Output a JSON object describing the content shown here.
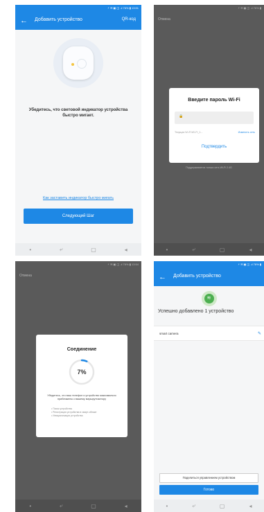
{
  "screen1": {
    "status": "⚡ ✉ ▣ ◫ .ıl 76% ▮ 13:51",
    "title": "Добавить устройство",
    "right_action": "QR-код",
    "instruction": "Убедитесь, что световой индикатор устройства быстро мигает.",
    "help_link": "Как заставить индикатор быстро мигать",
    "next_button": "Следующий Шаг"
  },
  "screen2": {
    "status": "⚡ ✉ ▣ ◫ .ıl 76% ▮",
    "cancel": "Отмена",
    "dialog_title": "Введите пароль Wi-Fi",
    "current_network": "Текущая Wi-Fi:WI-FI_1...",
    "change_network": "Изменить сеть",
    "confirm": "Подтвердить",
    "support_note": "Поддерживается только сеть Wi-Fi 2.4G"
  },
  "screen3": {
    "status": "⚡ ✉ ▣ ◫ .ıl 76% ▮ 13:54",
    "cancel": "Отмена",
    "dialog_title": "Соединение",
    "percent": "7%",
    "progress": 0.07,
    "note": "Убедитесь, что ваш телефон и устройство максимально приближены к вашему маршрутизатору",
    "steps": [
      "Поиск устройства",
      "Регистрация устройства в смарт-облаке",
      "Инициализация устройства"
    ]
  },
  "screen4": {
    "status": "⚡ ✉ ▣ ◫ .ıl 76% ▮",
    "title": "Добавить устройство",
    "success": "Успешно добавлено 1 устройство",
    "device_name": "smart camera",
    "share_button": "Поделиться управлением устройством",
    "done_button": "Готово"
  },
  "nav": {
    "back": "◂",
    "home": "▢",
    "recents": "⤶",
    "menu": "•"
  },
  "icons": {
    "back_arrow": "←",
    "lock": "🔒",
    "wifi": "≋",
    "edit": "✎"
  },
  "colors": {
    "primary": "#1e88e5",
    "success": "#4caf50"
  }
}
